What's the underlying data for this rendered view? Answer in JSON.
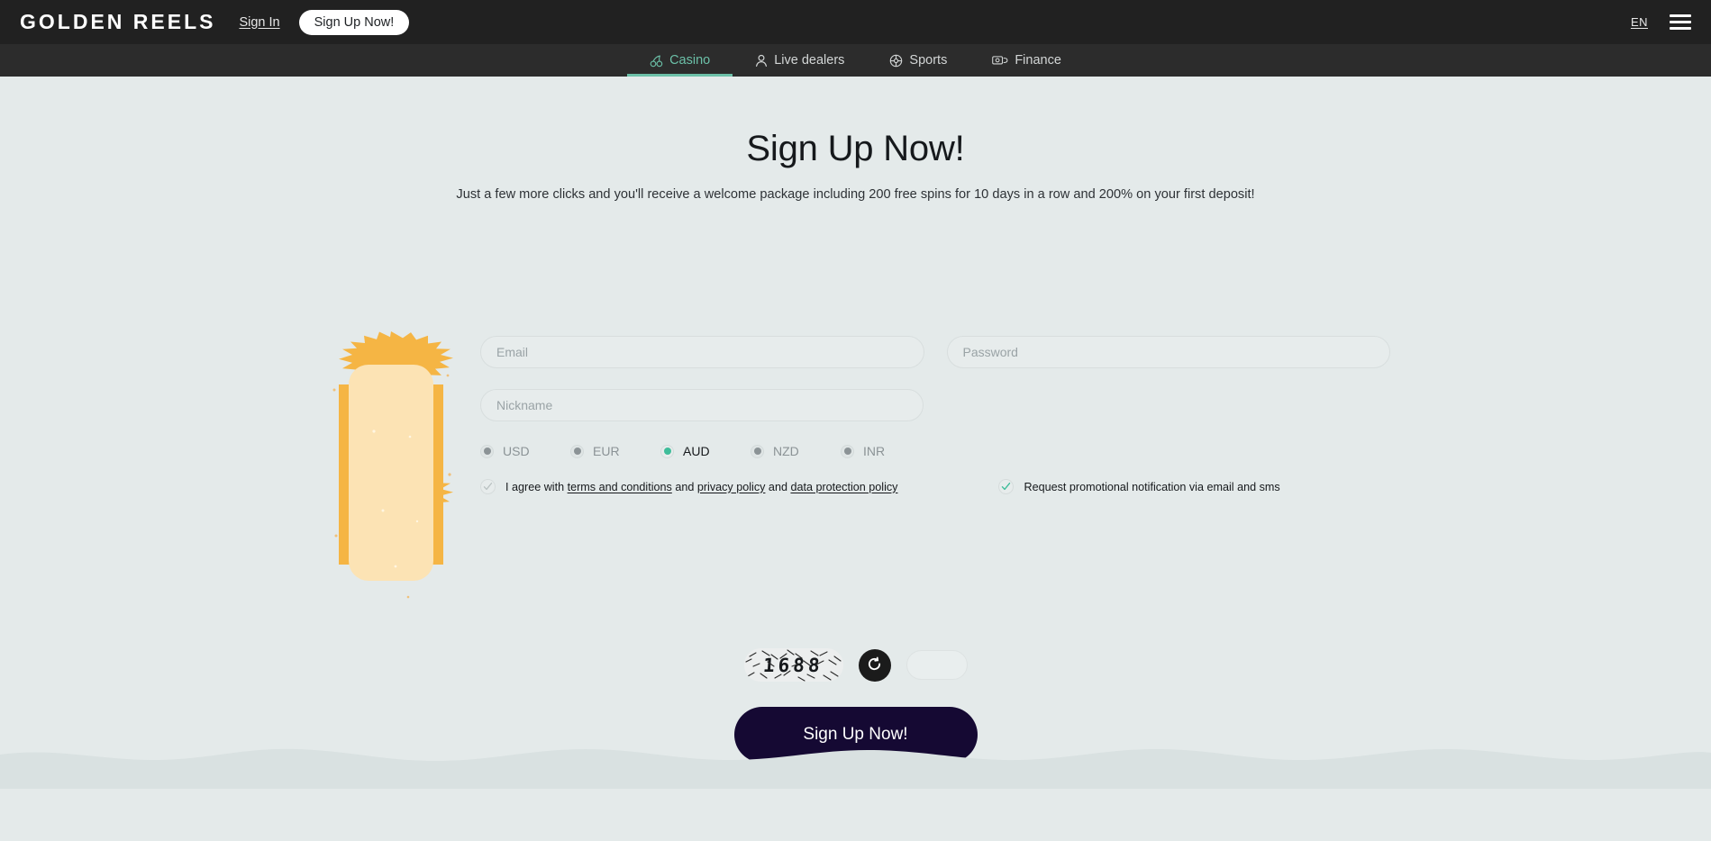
{
  "header": {
    "logo": "GOLDEN REELS",
    "sign_in": "Sign In",
    "sign_up": "Sign Up Now!",
    "language": "EN",
    "menu_icon": "hamburger-menu-icon"
  },
  "nav": {
    "tabs": [
      {
        "label": "Casino",
        "icon": "cherries-icon",
        "active": true
      },
      {
        "label": "Live dealers",
        "icon": "person-icon",
        "active": false
      },
      {
        "label": "Sports",
        "icon": "ball-icon",
        "active": false
      },
      {
        "label": "Finance",
        "icon": "money-card-icon",
        "active": false
      }
    ]
  },
  "main": {
    "title": "Sign Up Now!",
    "subtitle": "Just a few more clicks and you'll receive a welcome package including 200 free spins for 10 days in a row and 200% on your first deposit!",
    "fields": {
      "email_placeholder": "Email",
      "email_value": "",
      "password_placeholder": "Password",
      "password_value": "",
      "nickname_placeholder": "Nickname",
      "nickname_value": ""
    },
    "currencies": [
      {
        "code": "USD",
        "selected": false
      },
      {
        "code": "EUR",
        "selected": false
      },
      {
        "code": "AUD",
        "selected": true
      },
      {
        "code": "NZD",
        "selected": false
      },
      {
        "code": "INR",
        "selected": false
      }
    ],
    "terms": {
      "prefix": "I agree with ",
      "link1": "terms and conditions",
      "mid1": " and ",
      "link2": "privacy policy",
      "mid2": " and ",
      "link3": "data protection policy",
      "checked": true
    },
    "promo": {
      "label": "Request promotional notification via email and sms",
      "checked": true
    },
    "captcha": {
      "code": "1688",
      "refresh_icon": "refresh-icon",
      "input_value": "",
      "input_placeholder": ""
    },
    "submit_label": "Sign Up Now!"
  },
  "decor": {
    "starburst": "starburst-shape"
  },
  "colors": {
    "accent_teal": "#6cc0a8",
    "radio_teal": "#3fbd9a",
    "header_bg": "#212121",
    "nav_bg": "#2c2c2c",
    "page_bg": "#e4eaea",
    "submit_bg": "#150933",
    "burst_outer": "#f5b544",
    "burst_inner": "#fce3b4"
  }
}
